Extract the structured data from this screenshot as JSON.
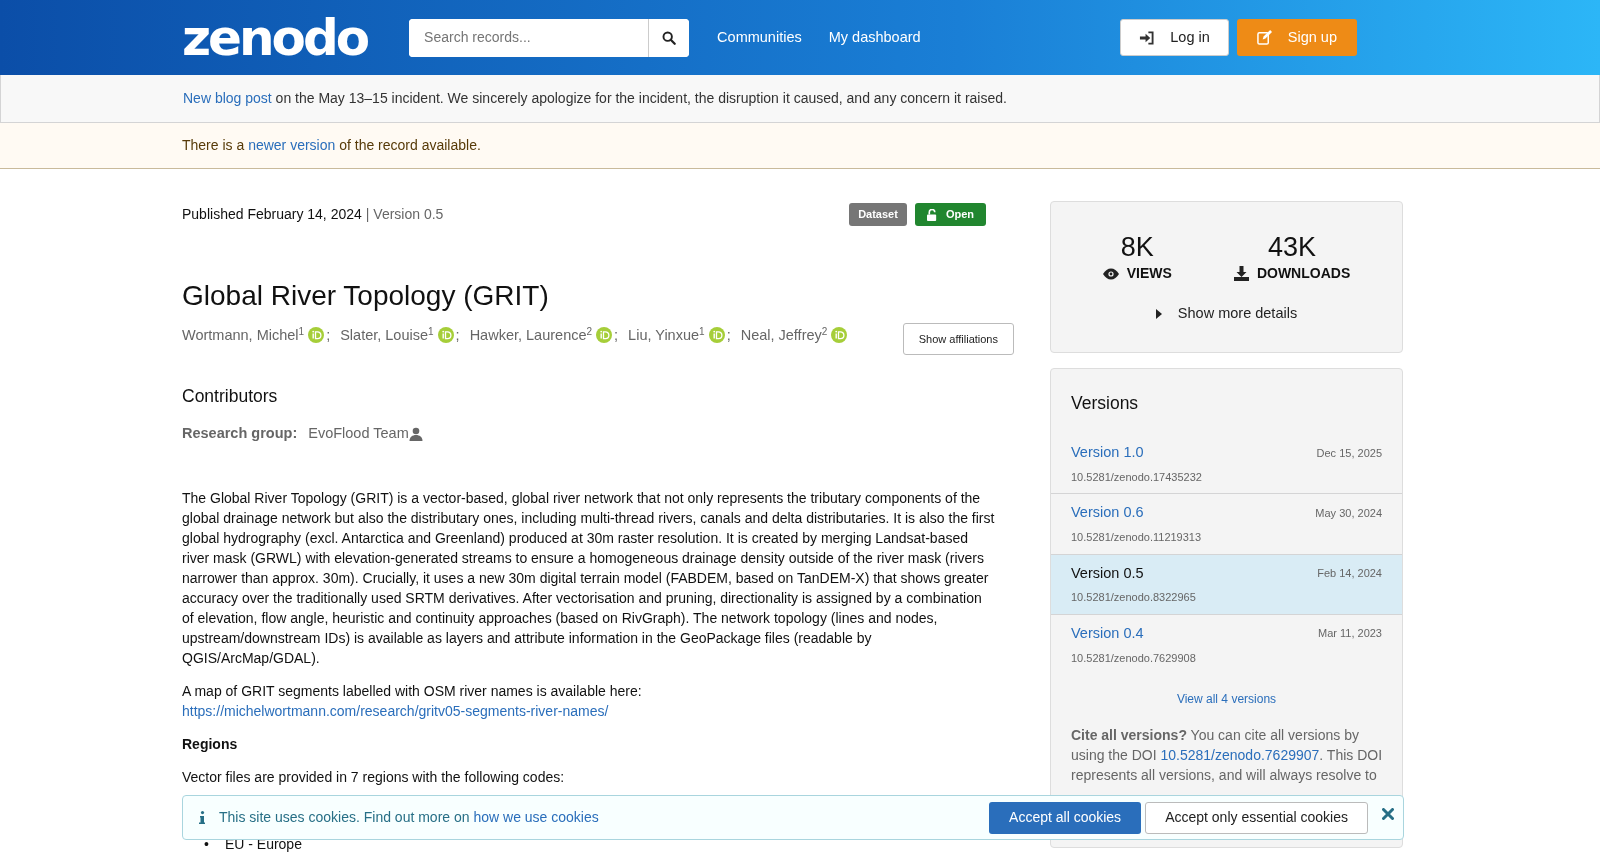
{
  "header": {
    "logo": "zenodo",
    "search": {
      "placeholder": "Search records..."
    },
    "nav": [
      "Communities",
      "My dashboard"
    ],
    "buttons": [
      {
        "label": "Log in",
        "kind": "login"
      },
      {
        "label": "Sign up",
        "kind": "signup"
      }
    ]
  },
  "announcement": {
    "link": "New blog post",
    "text": " on the May 13–15 incident. We sincerely apologize for the incident, the disruption it caused, and any concern it raised."
  },
  "version_notice": {
    "before": "There is a ",
    "link": "newer version",
    "after": " of the record available."
  },
  "record": {
    "published": "Published February 14, 2024",
    "version": "| Version 0.5",
    "badges": [
      {
        "label": "Dataset",
        "kind": "type"
      },
      {
        "label": "Open",
        "kind": "access"
      }
    ],
    "title": "Global River Topology (GRIT)",
    "creators": [
      {
        "name": "Wortmann, Michel",
        "affiliation": "1",
        "separator": ";"
      },
      {
        "name": "Slater, Louise",
        "affiliation": "1",
        "separator": ";"
      },
      {
        "name": "Hawker, Laurence",
        "affiliation": "2",
        "separator": ";"
      },
      {
        "name": "Liu, Yinxue",
        "affiliation": "1",
        "separator": ";"
      },
      {
        "name": "Neal, Jeffrey",
        "affiliation": "2"
      }
    ],
    "show_affiliations": "Show affiliations",
    "contributors_heading": "Contributors",
    "research_group": {
      "label": "Research group:",
      "value": "EvoFlood Team"
    },
    "description": "The Global River Topology (GRIT) is a vector-based, global river network that not only represents the tributary components of the global drainage network but also the distributary ones, including multi-thread rivers, canals and delta distributaries. It is also the first global hydrography (excl. Antarctica and Greenland) produced at 30m raster resolution. It is created by merging Landsat-based river mask (GRWL) with elevation-generated streams to ensure a homogeneous drainage density outside of the river mask (rivers narrower than approx. 30m). Crucially, it uses a new 30m digital terrain model (FABDEM, based on TanDEM-X) that shows greater accuracy over the traditionally used SRTM derivatives. After vectorisation and pruning, directionality is assigned by a combination of elevation, flow angle, heuristic and continuity approaches (based on RivGraph). The network topology (lines and nodes, upstream/downstream IDs) is available as layers and attribute information in the GeoPackage files (readable by QGIS/ArcMap/GDAL).",
    "map_text": "A map of GRIT segments labelled with OSM river names is available here: ",
    "map_link": "https://michelwortmann.com/research/gritv05-segments-river-names/",
    "regions_heading": "Regions",
    "regions_text": "Vector files are provided in 7 regions with the following codes:",
    "region_items": [
      {
        "marker": "•",
        "text": "EU - Europe"
      }
    ]
  },
  "stats": [
    {
      "value": "8K",
      "label": "VIEWS",
      "kind": "views"
    },
    {
      "value": "43K",
      "label": "DOWNLOADS",
      "kind": "downloads"
    }
  ],
  "show_more": "Show more details",
  "versions": {
    "title": "Versions",
    "items": [
      {
        "label": "Version 1.0",
        "date": "Dec 15, 2025",
        "doi": "10.5281/zenodo.17435232",
        "selected": false
      },
      {
        "label": "Version 0.6",
        "date": "May 30, 2024",
        "doi": "10.5281/zenodo.11219313",
        "selected": false
      },
      {
        "label": "Version 0.5",
        "date": "Feb 14, 2024",
        "doi": "10.5281/zenodo.8322965",
        "selected": true
      },
      {
        "label": "Version 0.4",
        "date": "Mar 11, 2023",
        "doi": "10.5281/zenodo.7629908",
        "selected": false
      }
    ],
    "view_all": "View all 4 versions",
    "cite": {
      "bold": "Cite all versions?",
      "before": " You can cite all versions by using the DOI ",
      "link": "10.5281/zenodo.7629907",
      "after": ". This DOI represents all versions, and will always resolve to"
    }
  },
  "cookie": {
    "text": "This site uses cookies. Find out more on ",
    "link": "how we use cookies",
    "buttons": [
      {
        "label": "Accept all cookies",
        "kind": "primary"
      },
      {
        "label": "Accept only essential cookies",
        "kind": "secondary"
      }
    ]
  }
}
